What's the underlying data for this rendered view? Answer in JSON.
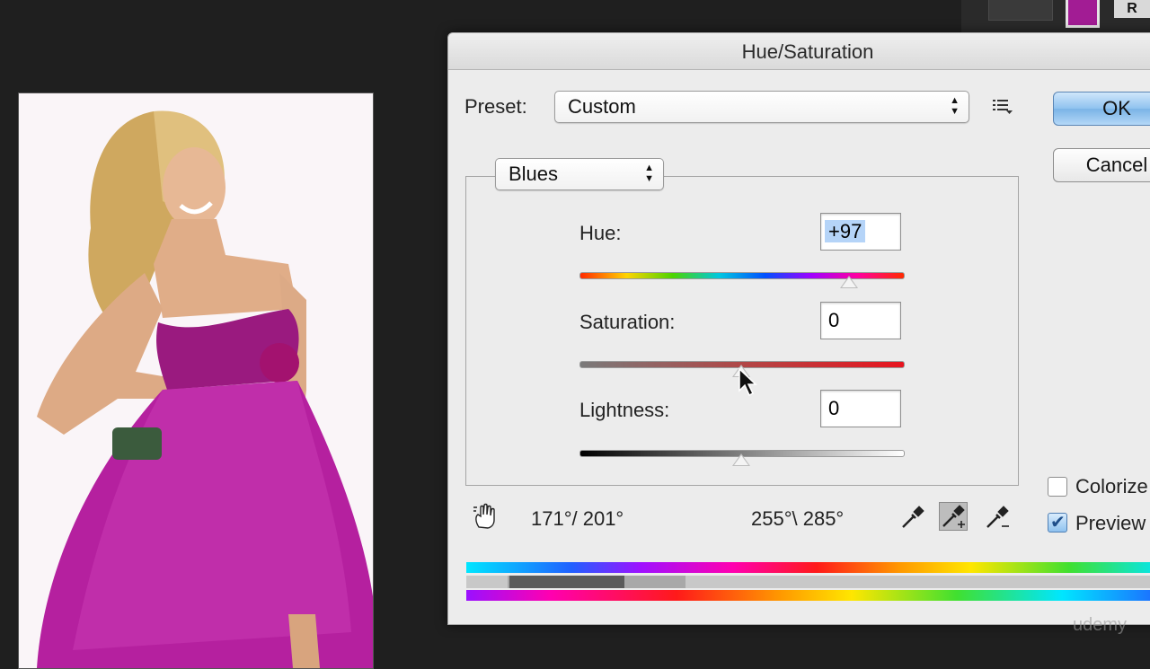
{
  "dialog": {
    "title": "Hue/Saturation",
    "preset_label": "Preset:",
    "preset_value": "Custom",
    "channel_value": "Blues",
    "ok_label": "OK",
    "cancel_label": "Cancel",
    "hue": {
      "label": "Hue:",
      "value": "+97",
      "slider_fraction": 0.75
    },
    "saturation": {
      "label": "Saturation:",
      "value": "0",
      "slider_fraction": 0.5
    },
    "lightness": {
      "label": "Lightness:",
      "value": "0",
      "slider_fraction": 0.5
    },
    "range_left": "171°/ 201°",
    "range_right": "255°\\ 285°",
    "colorize": {
      "label": "Colorize",
      "checked": false
    },
    "preview": {
      "label": "Preview",
      "checked": true
    }
  },
  "chrome": {
    "r_label": "R",
    "swatch_color": "#a21c94"
  },
  "colors": {
    "dress": "#b5209f",
    "skin": "#e2b08a",
    "hair": "#d9b46e"
  },
  "watermark": "udemy"
}
